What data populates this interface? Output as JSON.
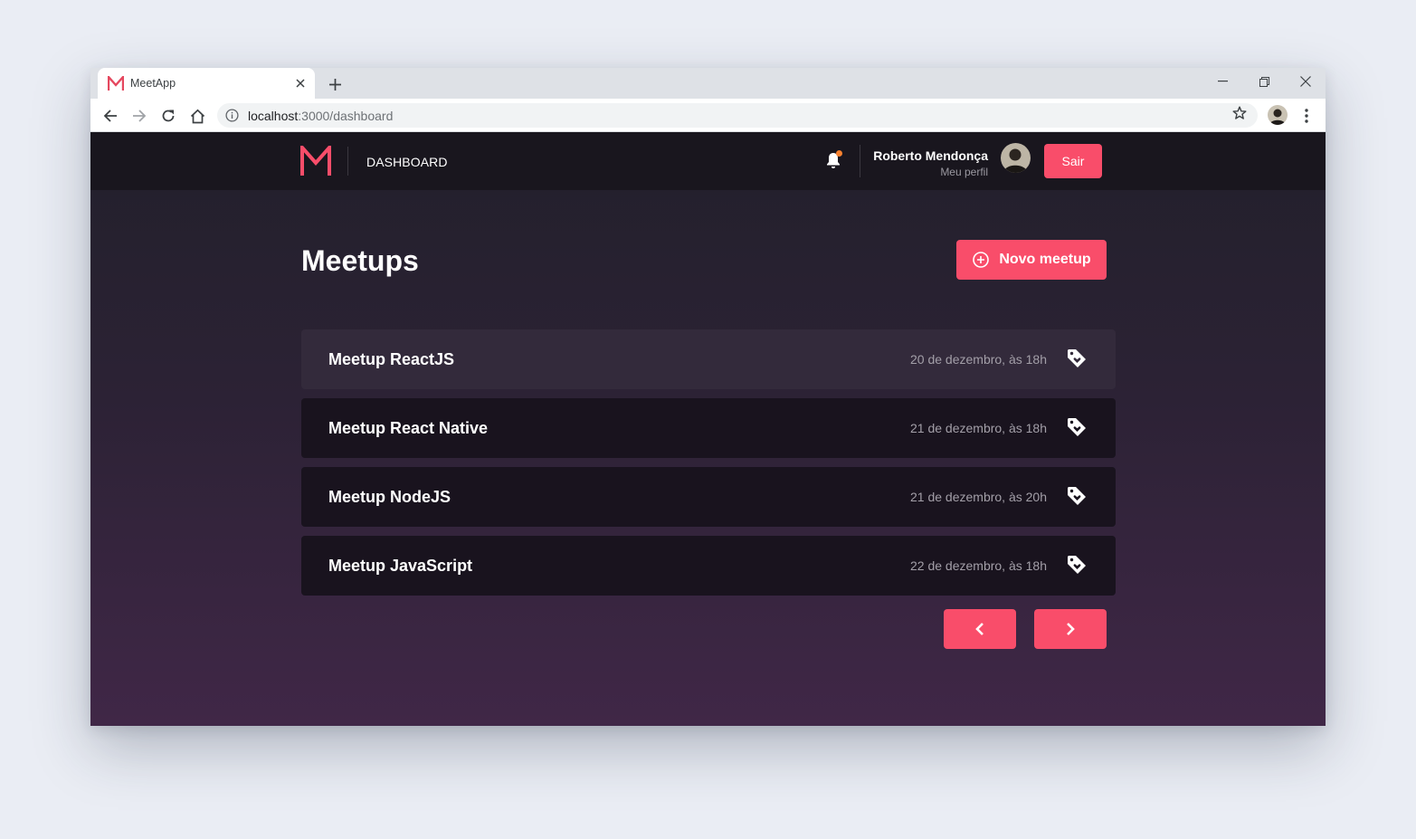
{
  "browser": {
    "tab_title": "MeetApp",
    "url_host": "localhost",
    "url_rest": ":3000/dashboard"
  },
  "header": {
    "nav_label": "DASHBOARD",
    "user_name": "Roberto Mendonça",
    "profile_link": "Meu perfil",
    "logout_label": "Sair",
    "has_notification": true
  },
  "main": {
    "title": "Meetups",
    "new_button_label": "Novo meetup",
    "meetups": [
      {
        "title": "Meetup ReactJS",
        "date": "20 de dezembro, às 18h"
      },
      {
        "title": "Meetup React Native",
        "date": "21 de dezembro, às 18h"
      },
      {
        "title": "Meetup NodeJS",
        "date": "21 de dezembro, às 20h"
      },
      {
        "title": "Meetup JavaScript",
        "date": "22 de dezembro, às 18h"
      }
    ]
  },
  "colors": {
    "accent": "#f94d6a",
    "header_bg": "#19161e",
    "card_bg": "#19131e",
    "card_hover_bg": "#332a3b",
    "notification_dot": "#f7812f"
  }
}
